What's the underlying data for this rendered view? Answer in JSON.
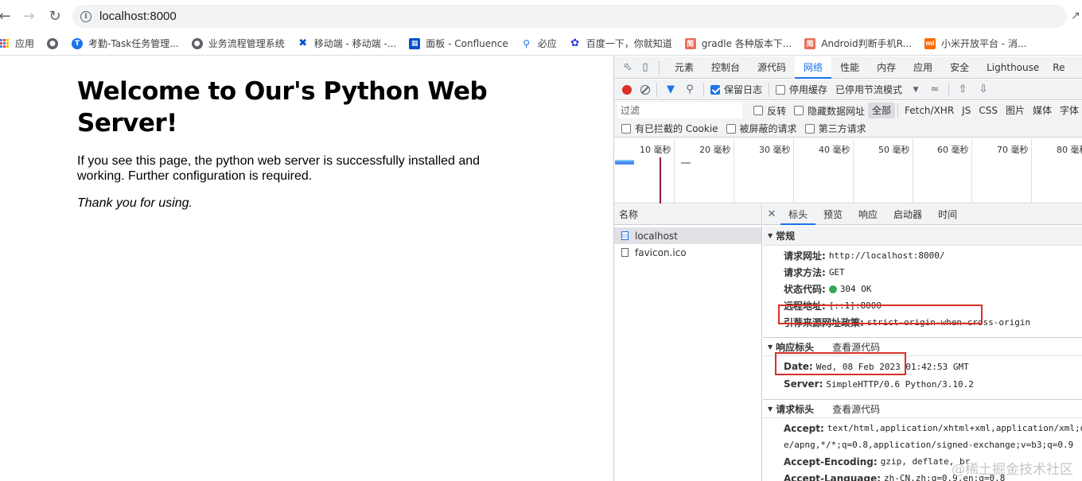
{
  "browser": {
    "url": "localhost:8000",
    "bookmarks": [
      {
        "label": "应用",
        "icon": "apps-grid-icon"
      },
      {
        "label": "",
        "icon": "globe-icon"
      },
      {
        "label": "考勤-Task任务管理...",
        "icon": "task-logo-icon"
      },
      {
        "label": "业务流程管理系统",
        "icon": "globe-icon"
      },
      {
        "label": "移动端 - 移动端 -...",
        "icon": "confluence-icon"
      },
      {
        "label": "面板 - Confluence",
        "icon": "confluence-icon"
      },
      {
        "label": "必应",
        "icon": "bing-icon"
      },
      {
        "label": "百度一下，你就知道",
        "icon": "baidu-paw-icon"
      },
      {
        "label": "gradle 各种版本下...",
        "icon": "jianshu-icon"
      },
      {
        "label": "Android判断手机R...",
        "icon": "jianshu-icon"
      },
      {
        "label": "小米开放平台 - 消...",
        "icon": "xiaomi-icon"
      }
    ]
  },
  "page": {
    "title": "Welcome to Our's Python Web Server!",
    "paragraph": "If you see this page, the python web server is successfully installed and working. Further configuration is required.",
    "thanks": "Thank you for using."
  },
  "devtools": {
    "tabs": [
      "元素",
      "控制台",
      "源代码",
      "网络",
      "性能",
      "内存",
      "应用",
      "安全",
      "Lighthouse",
      "Re"
    ],
    "active_tab": "网络",
    "toolbar": {
      "preserve_log": "保留日志",
      "disable_cache": "停用缓存",
      "throttling": "已停用节流模式"
    },
    "filter": {
      "placeholder": "过滤",
      "invert": "反转",
      "hide_data_urls": "隐藏数据网址",
      "types": [
        "全部",
        "Fetch/XHR",
        "JS",
        "CSS",
        "图片",
        "媒体",
        "字体"
      ],
      "blocked_cookies": "有已拦截的 Cookie",
      "blocked_requests": "被屏蔽的请求",
      "third_party": "第三方请求"
    },
    "timeline_ticks": [
      "10 毫秒",
      "20 毫秒",
      "30 毫秒",
      "40 毫秒",
      "50 毫秒",
      "60 毫秒",
      "70 毫秒",
      "80 毫秒"
    ],
    "name_header": "名称",
    "requests": [
      "localhost",
      "favicon.ico"
    ],
    "detail_tabs": [
      "标头",
      "预览",
      "响应",
      "启动器",
      "时间"
    ],
    "general": {
      "title": "常规",
      "request_url_k": "请求网址:",
      "request_url_v": "http://localhost:8000/",
      "method_k": "请求方法:",
      "method_v": "GET",
      "status_k": "状态代码:",
      "status_v": "304 OK",
      "remote_k": "远程地址:",
      "remote_v": "[::1]:8000",
      "referrer_k": "引荐来源网址政策:",
      "referrer_v": "strict-origin-when-cross-origin"
    },
    "response_headers": {
      "title": "响应标头",
      "view_source": "查看源代码",
      "date_k": "Date:",
      "date_v": "Wed, 08 Feb 2023 01:42:53 GMT",
      "server_k": "Server:",
      "server_v": "SimpleHTTP/0.6 Python/3.10.2"
    },
    "request_headers": {
      "title": "请求标头",
      "view_source": "查看源代码",
      "accept_k": "Accept:",
      "accept_v1": "text/html,application/xhtml+xml,application/xml;q=",
      "accept_v2": "e/apng,*/*;q=0.8,application/signed-exchange;v=b3;q=0.9",
      "encoding_k": "Accept-Encoding:",
      "encoding_v": "gzip, deflate, br",
      "language_k": "Accept-Language:",
      "language_v": "zh-CN,zh;q=0.9,en;q=0.8"
    }
  },
  "watermark": "@稀土掘金技术社区",
  "colors": {
    "accent": "#1a73e8",
    "record": "#d93025",
    "status_ok": "#34a853",
    "highlight_box": "#d93025"
  }
}
